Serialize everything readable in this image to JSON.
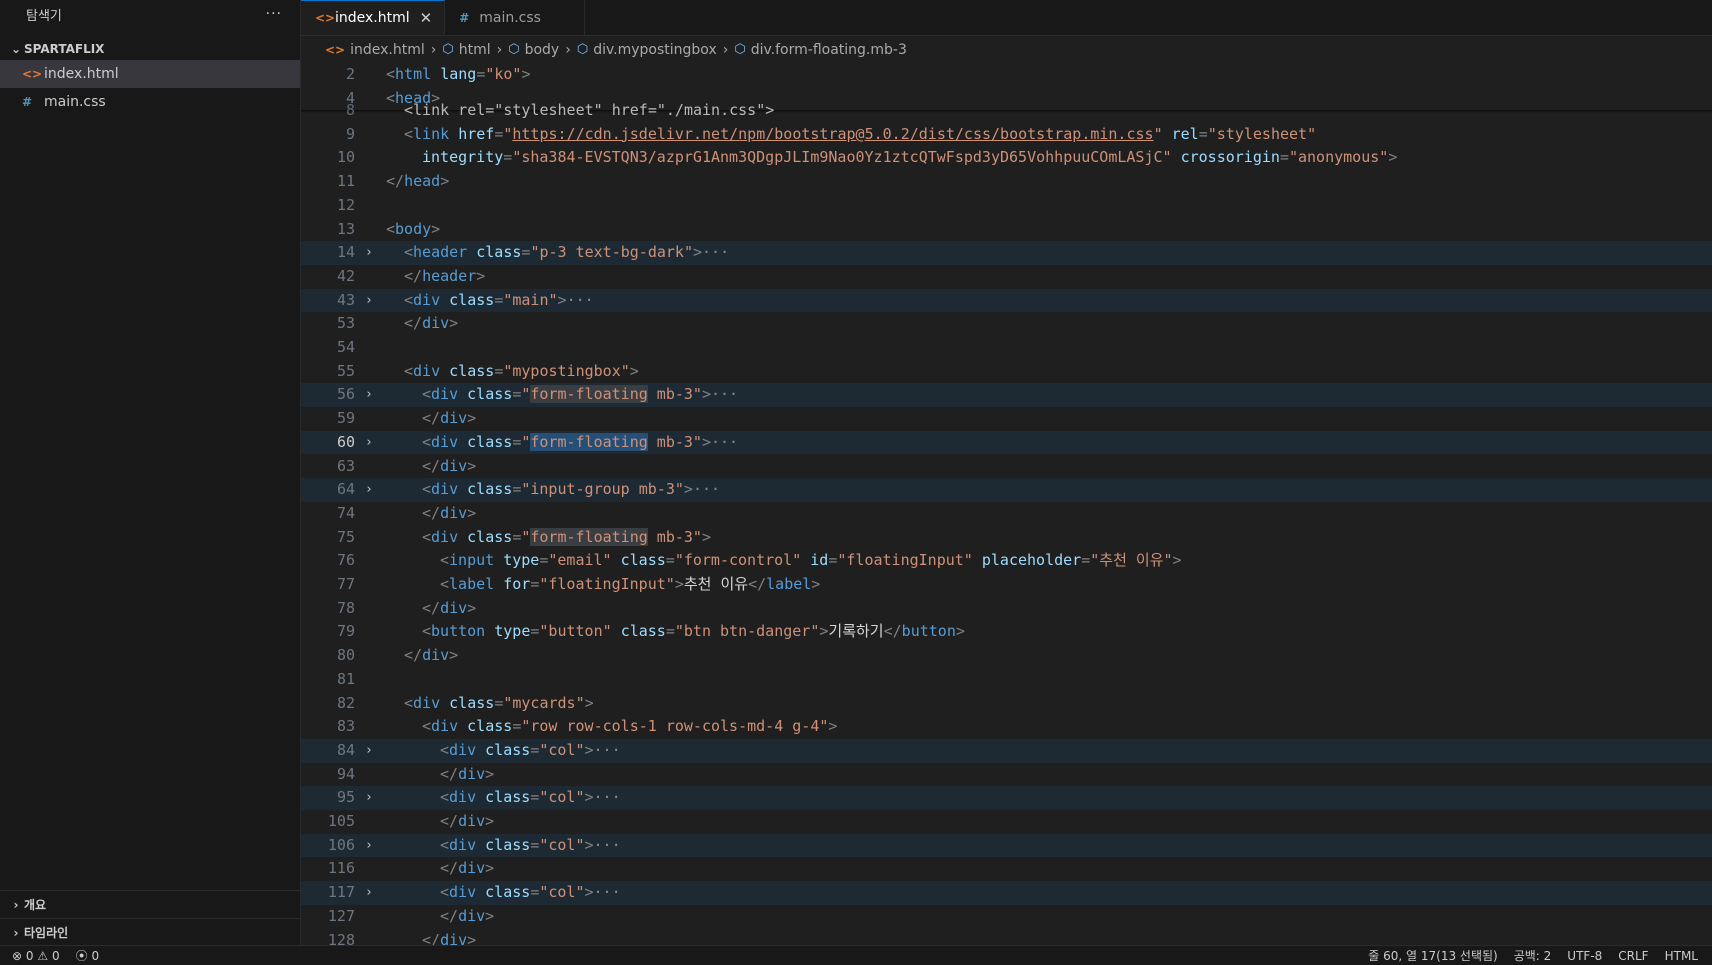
{
  "sidebar": {
    "title": "탐색기",
    "more": "···",
    "project": "SPARTAFLIX",
    "files": [
      {
        "name": "index.html",
        "icon": "<>"
      },
      {
        "name": "main.css",
        "icon": "#"
      }
    ],
    "bottom": [
      "개요",
      "타임라인"
    ]
  },
  "tabs": [
    {
      "label": "index.html",
      "icon": "<>",
      "close": "✕"
    },
    {
      "label": "main.css",
      "icon": "#"
    }
  ],
  "breadcrumb": [
    "index.html",
    "html",
    "body",
    "div.mypostingbox",
    "div.form-floating.mb-3"
  ],
  "editor": {
    "lines": [
      "2",
      "4",
      "8",
      "9",
      "10",
      "11",
      "12",
      "13",
      "14",
      "42",
      "43",
      "53",
      "54",
      "55",
      "56",
      "59",
      "60",
      "63",
      "64",
      "74",
      "75",
      "76",
      "77",
      "78",
      "79",
      "80",
      "81",
      "82",
      "83",
      "84",
      "94",
      "95",
      "105",
      "106",
      "116",
      "117",
      "127",
      "128"
    ],
    "code": {
      "l2_tag": "html",
      "l2_attr": "lang",
      "l2_val": "\"ko\"",
      "l4_tag": "head",
      "l8": "<link rel=\"stylesheet\" href=\"./main.css\">",
      "l9_tag": "link",
      "l9_href": "href",
      "l9_url": "https://cdn.jsdelivr.net/npm/bootstrap@5.0.2/dist/css/bootstrap.min.css",
      "l9_rel": "rel",
      "l9_relval": "\"stylesheet\"",
      "l10_integrity": "integrity",
      "l10_intval": "\"sha384-EVSTQN3/azprG1Anm3QDgpJLIm9Nao0Yz1ztcQTwFspd3yD65VohhpuuCOmLASjC\"",
      "l10_cross": "crossorigin",
      "l10_crossval": "\"anonymous\"",
      "l11_tag": "head",
      "l13_tag": "body",
      "l14_tag": "header",
      "l14_attr": "class",
      "l14_val": "\"p-3 text-bg-dark\"",
      "l42_tag": "header",
      "l43_tag": "div",
      "l43_val": "\"main\"",
      "l53_tag": "div",
      "l55_tag": "div",
      "l55_val": "\"mypostingbox\"",
      "l56_val_a": "form-floating",
      "l56_val_b": " mb-3\"",
      "l64_val": "\"input-group mb-3\"",
      "l76_tag": "input",
      "l76_type": "type",
      "l76_typeval": "\"email\"",
      "l76_classval": "\"form-control\"",
      "l76_id": "id",
      "l76_idval": "\"floatingInput\"",
      "l76_ph": "placeholder",
      "l76_phval": "\"추천 이유\"",
      "l77_tag": "label",
      "l77_for": "for",
      "l77_forval": "\"floatingInput\"",
      "l77_text": "추천 이유",
      "l79_tag": "button",
      "l79_typeval": "\"button\"",
      "l79_classval": "\"btn btn-danger\"",
      "l79_text": "기록하기",
      "l82_val": "\"mycards\"",
      "l83_val": "\"row row-cols-1 row-cols-md-4 g-4\"",
      "col_val": "\"col\"",
      "class": "class",
      "ellipsis": "···"
    }
  },
  "status": {
    "errors": "0",
    "warnings": "0",
    "ports": "0",
    "position": "줄 60, 열 17(13 선택됨)",
    "spaces": "공백: 2",
    "encoding": "UTF-8",
    "eol": "CRLF",
    "language": "HTML"
  }
}
